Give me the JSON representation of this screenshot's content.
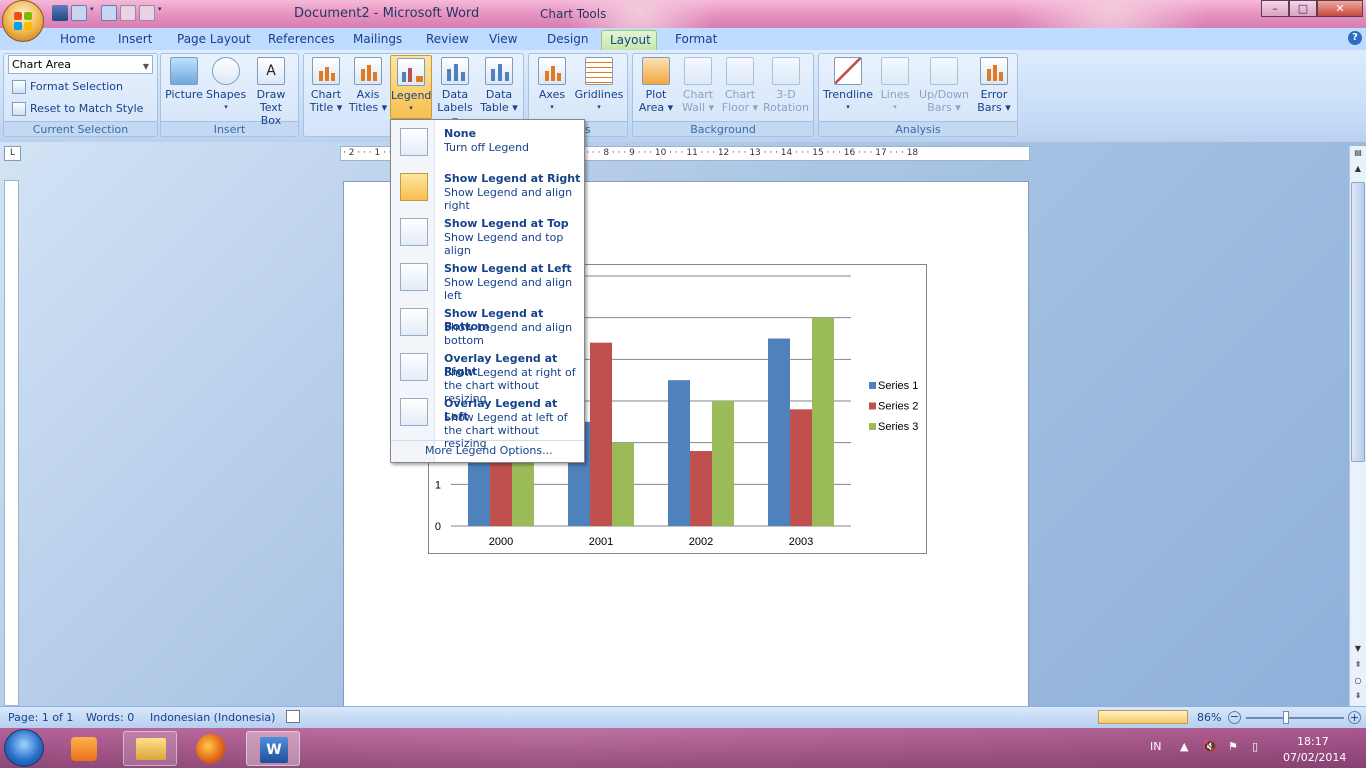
{
  "window": {
    "title": "Document2 - Microsoft Word",
    "context_title": "Chart Tools",
    "min_label": "–",
    "max_label": "□",
    "close_label": "✕"
  },
  "tabs": [
    "Home",
    "Insert",
    "Page Layout",
    "References",
    "Mailings",
    "Review",
    "View",
    "Design",
    "Layout",
    "Format"
  ],
  "current_selection": {
    "dropdown_value": "Chart Area",
    "format_selection": "Format Selection",
    "reset_style": "Reset to Match Style",
    "group_label": "Current Selection"
  },
  "insert_group": {
    "label": "Insert",
    "picture": "Picture",
    "shapes": "Shapes",
    "draw1": "Draw",
    "draw2": "Text Box"
  },
  "labels_group": {
    "chart_title1": "Chart",
    "chart_title2": "Title",
    "axis_titles1": "Axis",
    "axis_titles2": "Titles",
    "legend": "Legend",
    "data_labels1": "Data",
    "data_labels2": "Labels",
    "data_table1": "Data",
    "data_table2": "Table"
  },
  "axes_group": {
    "axes": "Axes",
    "gridlines": "Gridlines",
    "label_frag": "s"
  },
  "background_group": {
    "label": "Background",
    "plot1": "Plot",
    "plot2": "Area",
    "wall1": "Chart",
    "wall2": "Wall",
    "floor1": "Chart",
    "floor2": "Floor",
    "rot1": "3-D",
    "rot2": "Rotation"
  },
  "analysis_group": {
    "label": "Analysis",
    "trendline": "Trendline",
    "lines": "Lines",
    "updown1": "Up/Down",
    "updown2": "Bars",
    "error1": "Error",
    "error2": "Bars"
  },
  "legend_menu": {
    "items": [
      {
        "title": "None",
        "desc": "Turn off Legend"
      },
      {
        "title": "Show Legend at Right",
        "desc": "Show Legend and align right"
      },
      {
        "title": "Show Legend at Top",
        "desc": "Show Legend and top align"
      },
      {
        "title": "Show Legend at Left",
        "desc": "Show Legend and align left"
      },
      {
        "title": "Show Legend at Bottom",
        "desc": "Show Legend and align bottom"
      },
      {
        "title": "Overlay Legend at Right",
        "desc": "Show Legend at right of the chart without resizing"
      },
      {
        "title": "Overlay Legend at Left",
        "desc": "Show Legend at left of the chart without resizing"
      }
    ],
    "more": "More Legend Options..."
  },
  "ruler": {
    "marks": "· 2 · · · 1 · · · · · · · 1 · · · 2 · · · 3 · · · 4 · · · 5 · · · 6 · · · 7 · · · 8 · · · 9 · · · 10 · · · 11 · · · 12 · · · 13 · · · 14 · · · 15 · · · 16 · · · 17 · · · 18"
  },
  "chart_data": {
    "type": "bar",
    "categories": [
      "2000",
      "2001",
      "2002",
      "2003"
    ],
    "series": [
      {
        "name": "Series 1",
        "values": [
          4.3,
          2.5,
          3.5,
          4.5
        ],
        "color": "#4f81bd"
      },
      {
        "name": "Series 2",
        "values": [
          2.4,
          4.4,
          1.8,
          2.8
        ],
        "color": "#c0504d"
      },
      {
        "name": "Series 3",
        "values": [
          2,
          2,
          3,
          5
        ],
        "color": "#9bbb59"
      }
    ],
    "ylim": [
      0,
      6
    ],
    "visible_y_ticks": [
      "0",
      "1"
    ],
    "grid": true,
    "legend": "right"
  },
  "status": {
    "page": "Page: 1 of 1",
    "words": "Words: 0",
    "language": "Indonesian (Indonesia)",
    "zoom": "86%"
  },
  "taskbar": {
    "lang": "IN",
    "time": "18:17",
    "date": "07/02/2014"
  }
}
